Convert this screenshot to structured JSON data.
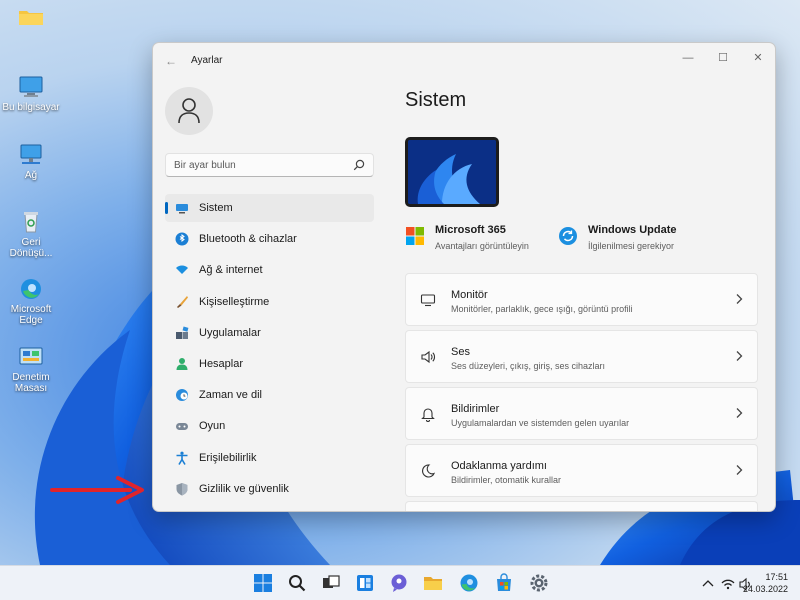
{
  "desktop": {
    "icons": [
      {
        "label": "Bu bilgisayar"
      },
      {
        "label": "Ağ"
      },
      {
        "label": "Geri Dönüşü..."
      },
      {
        "label": "Microsoft Edge"
      },
      {
        "label": "Denetim Masası"
      }
    ]
  },
  "window": {
    "title": "Ayarlar",
    "controls": {
      "minimize": "—",
      "maximize": "☐",
      "close": "✕"
    }
  },
  "search": {
    "placeholder": "Bir ayar bulun"
  },
  "nav": {
    "items": [
      {
        "label": "Sistem",
        "icon": "monitor-icon",
        "active": true
      },
      {
        "label": "Bluetooth & cihazlar",
        "icon": "bluetooth-icon"
      },
      {
        "label": "Ağ & internet",
        "icon": "wifi-icon"
      },
      {
        "label": "Kişiselleştirme",
        "icon": "brush-icon"
      },
      {
        "label": "Uygulamalar",
        "icon": "apps-icon"
      },
      {
        "label": "Hesaplar",
        "icon": "person-icon"
      },
      {
        "label": "Zaman ve dil",
        "icon": "globe-clock-icon"
      },
      {
        "label": "Oyun",
        "icon": "gamepad-icon"
      },
      {
        "label": "Erişilebilirlik",
        "icon": "accessibility-icon"
      },
      {
        "label": "Gizlilik ve güvenlik",
        "icon": "shield-icon"
      }
    ]
  },
  "main": {
    "title": "Sistem",
    "info": [
      {
        "title": "Microsoft 365",
        "subtitle": "Avantajları görüntüleyin",
        "icon": "microsoft-logo-icon"
      },
      {
        "title": "Windows Update",
        "subtitle": "İlgilenilmesi gerekiyor",
        "icon": "update-icon"
      }
    ],
    "cards": [
      {
        "title": "Monitör",
        "subtitle": "Monitörler, parlaklık, gece ışığı, görüntü profili",
        "icon": "monitor-icon"
      },
      {
        "title": "Ses",
        "subtitle": "Ses düzeyleri, çıkış, giriş, ses cihazları",
        "icon": "speaker-icon"
      },
      {
        "title": "Bildirimler",
        "subtitle": "Uygulamalardan ve sistemden gelen uyarılar",
        "icon": "bell-icon"
      },
      {
        "title": "Odaklanma yardımı",
        "subtitle": "Bildirimler, otomatik kurallar",
        "icon": "moon-icon"
      }
    ]
  },
  "taskbar": {
    "apps": [
      "windows-start-icon",
      "search-icon",
      "task-view-icon",
      "widgets-icon",
      "chat-icon",
      "file-explorer-icon",
      "edge-icon",
      "store-icon",
      "settings-icon"
    ],
    "time": "17:51",
    "date": "24.03.2022"
  },
  "colors": {
    "accent": "#0067c0",
    "arrow": "#e0242b"
  }
}
